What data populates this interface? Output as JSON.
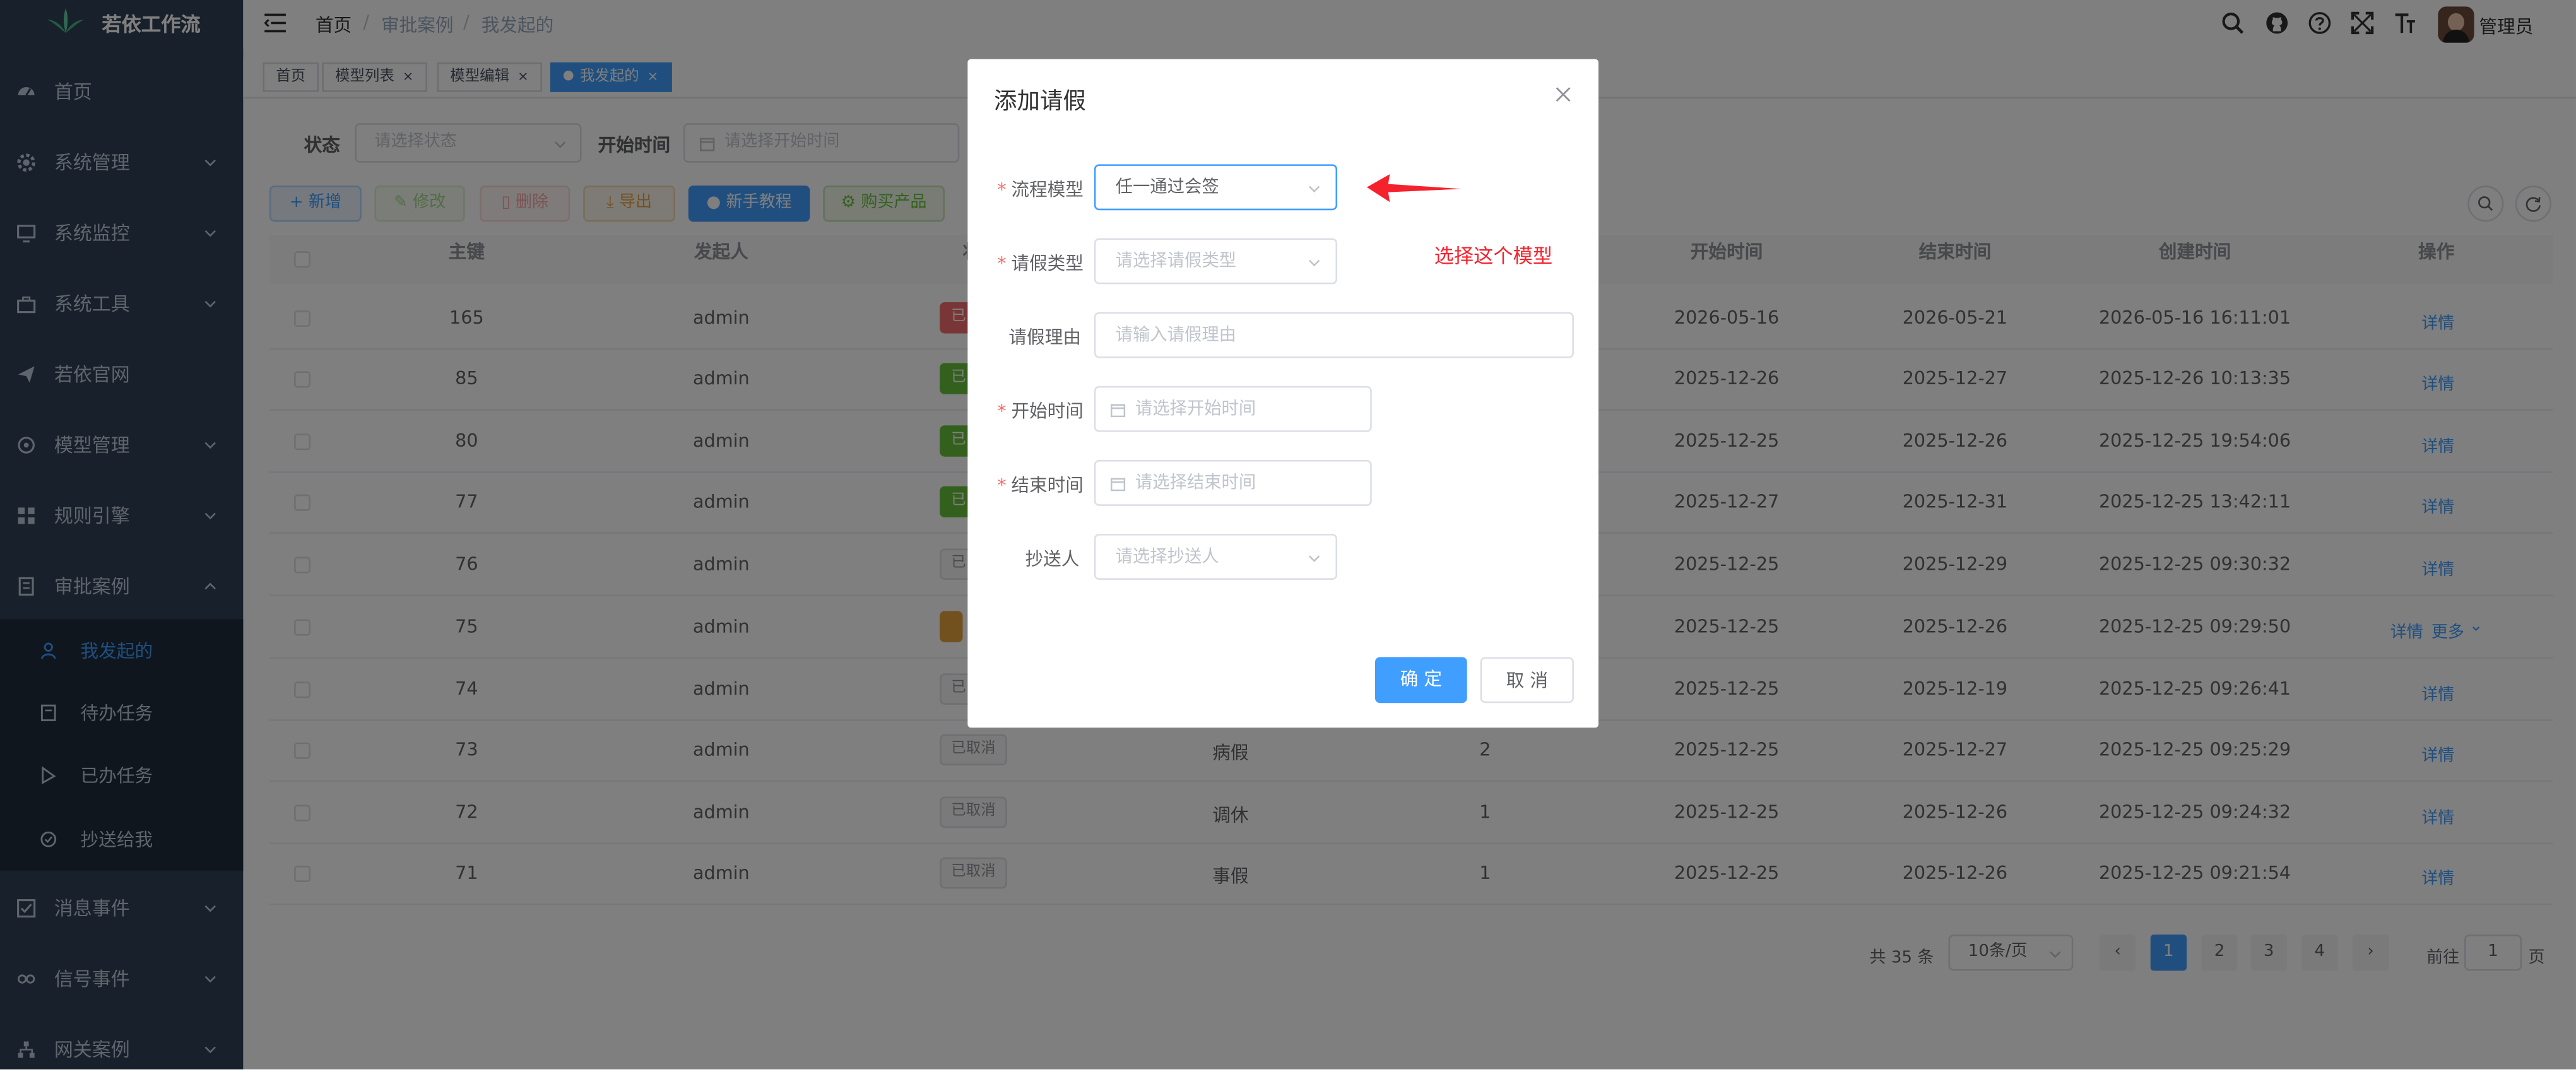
{
  "app": {
    "title": "若依工作流"
  },
  "sidebar": {
    "items": [
      {
        "label": "首页",
        "icon": "dashboard-icon"
      },
      {
        "label": "系统管理",
        "icon": "gear-icon"
      },
      {
        "label": "系统监控",
        "icon": "monitor-icon"
      },
      {
        "label": "系统工具",
        "icon": "toolbox-icon"
      },
      {
        "label": "若依官网",
        "icon": "paper-plane-icon"
      },
      {
        "label": "模型管理",
        "icon": "model-icon"
      },
      {
        "label": "规则引擎",
        "icon": "grid-icon"
      },
      {
        "label": "审批案例",
        "icon": "document-icon"
      },
      {
        "label": "消息事件",
        "icon": "checkbox-icon"
      },
      {
        "label": "信号事件",
        "icon": "signal-icon"
      },
      {
        "label": "网关案例",
        "icon": "tree-icon"
      }
    ],
    "submenu": [
      {
        "label": "我发起的",
        "icon": "user-icon"
      },
      {
        "label": "待办任务",
        "icon": "todo-icon"
      },
      {
        "label": "已办任务",
        "icon": "done-icon"
      },
      {
        "label": "抄送给我",
        "icon": "cc-icon"
      }
    ]
  },
  "breadcrumb": [
    "首页",
    "审批案例",
    "我发起的"
  ],
  "navbar": {
    "user": "管理员"
  },
  "tags": [
    {
      "label": "首页"
    },
    {
      "label": "模型列表",
      "close": "×"
    },
    {
      "label": "模型编辑",
      "close": "×"
    },
    {
      "label": "我发起的",
      "close": "×"
    }
  ],
  "search": {
    "status_label": "状态",
    "status_placeholder": "请选择状态",
    "start_label": "开始时间",
    "start_placeholder": "请选择开始时间"
  },
  "toolbar": {
    "add": "新增",
    "edit": "修改",
    "delete": "删除",
    "export": "导出",
    "tutorial": "新手教程",
    "buy": "购买产品"
  },
  "table": {
    "columns": [
      "主键",
      "发起人",
      "状",
      "开始时间",
      "结束时间",
      "创建时间",
      "操作"
    ],
    "rows": [
      {
        "id": "165",
        "user": "admin",
        "status": "已",
        "status_color": "#f56c6c",
        "type": "",
        "days": "",
        "start": "2026-05-16",
        "end": "2026-05-21",
        "created": "2026-05-16 16:11:01",
        "op": "详情",
        "more": ""
      },
      {
        "id": "85",
        "user": "admin",
        "status": "已",
        "status_color": "#67c23a",
        "type": "",
        "days": "",
        "start": "2025-12-26",
        "end": "2025-12-27",
        "created": "2025-12-26 10:13:35",
        "op": "详情",
        "more": ""
      },
      {
        "id": "80",
        "user": "admin",
        "status": "已",
        "status_color": "#67c23a",
        "type": "",
        "days": "",
        "start": "2025-12-25",
        "end": "2025-12-26",
        "created": "2025-12-25 19:54:06",
        "op": "详情",
        "more": ""
      },
      {
        "id": "77",
        "user": "admin",
        "status": "已",
        "status_color": "#67c23a",
        "type": "",
        "days": "",
        "start": "2025-12-27",
        "end": "2025-12-31",
        "created": "2025-12-25 13:42:11",
        "op": "详情",
        "more": ""
      },
      {
        "id": "76",
        "user": "admin",
        "status": "已",
        "status_color": "",
        "type": "",
        "days": "",
        "start": "2025-12-25",
        "end": "2025-12-29",
        "created": "2025-12-25 09:30:32",
        "op": "详情",
        "more": ""
      },
      {
        "id": "75",
        "user": "admin",
        "status": "",
        "status_color": "#e6a23c",
        "type": "",
        "days": "",
        "start": "2025-12-25",
        "end": "2025-12-26",
        "created": "2025-12-25 09:29:50",
        "op": "详情",
        "more": "更多"
      },
      {
        "id": "74",
        "user": "admin",
        "status": "已",
        "status_color": "",
        "type": "",
        "days": "",
        "start": "2025-12-25",
        "end": "2025-12-19",
        "created": "2025-12-25 09:26:41",
        "op": "详情",
        "more": ""
      },
      {
        "id": "73",
        "user": "admin",
        "status": "已取消",
        "status_color": "",
        "type": "病假",
        "days": "2",
        "start": "2025-12-25",
        "end": "2025-12-27",
        "created": "2025-12-25 09:25:29",
        "op": "详情",
        "more": ""
      },
      {
        "id": "72",
        "user": "admin",
        "status": "已取消",
        "status_color": "",
        "type": "调休",
        "days": "1",
        "start": "2025-12-25",
        "end": "2025-12-26",
        "created": "2025-12-25 09:24:32",
        "op": "详情",
        "more": ""
      },
      {
        "id": "71",
        "user": "admin",
        "status": "已取消",
        "status_color": "",
        "type": "事假",
        "days": "1",
        "start": "2025-12-25",
        "end": "2025-12-26",
        "created": "2025-12-25 09:21:54",
        "op": "详情",
        "more": ""
      }
    ]
  },
  "pagination": {
    "total": "共 35 条",
    "page_size": "10条/页",
    "pages": [
      "1",
      "2",
      "3",
      "4"
    ],
    "current": "1",
    "goto_label": "前往",
    "goto_value": "1",
    "page_suffix": "页"
  },
  "dialog": {
    "title": "添加请假",
    "fields": {
      "model": {
        "label": "流程模型",
        "value": "任一通过会签"
      },
      "leave_type": {
        "label": "请假类型",
        "placeholder": "请选择请假类型"
      },
      "reason": {
        "label": "请假理由",
        "placeholder": "请输入请假理由"
      },
      "start": {
        "label": "开始时间",
        "placeholder": "请选择开始时间"
      },
      "end": {
        "label": "结束时间",
        "placeholder": "请选择结束时间"
      },
      "cc": {
        "label": "抄送人",
        "placeholder": "请选择抄送人"
      }
    },
    "required_mark": "*",
    "ok": "确 定",
    "cancel": "取 消"
  },
  "annotation": {
    "text": "选择这个模型",
    "color": "#f5222d"
  }
}
